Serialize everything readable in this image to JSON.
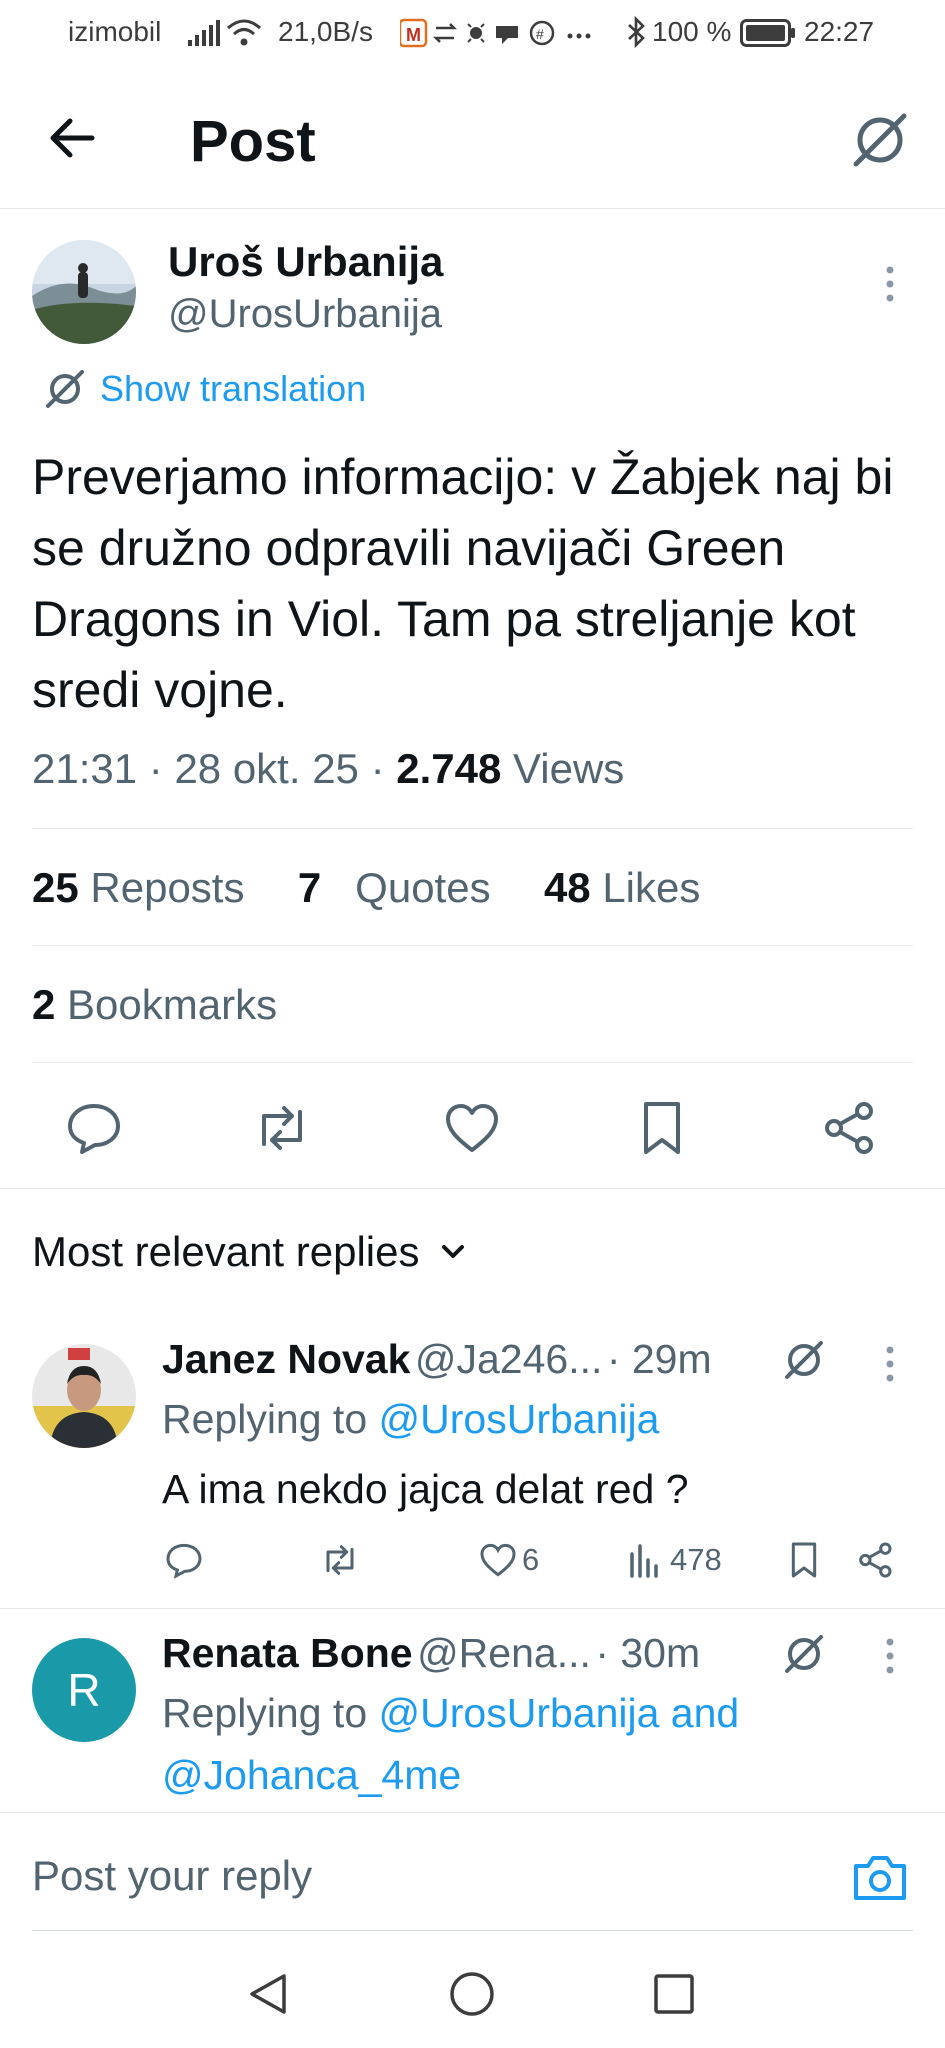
{
  "status_bar": {
    "carrier": "izimobil",
    "speed": "21,0B/s",
    "battery": "100 %",
    "time": "22:27",
    "icons": [
      "signal-icon",
      "wifi-icon",
      "app-notification-icons",
      "bluetooth-icon",
      "battery-icon"
    ]
  },
  "header": {
    "title": "Post"
  },
  "post": {
    "author_name": "Uroš Urbanija",
    "author_handle": "@UrosUrbanija",
    "show_translation": "Show translation",
    "text": "Preverjamo informacijo: v Žabjek naj bi se družno odpravili navijači Green Dragons in Viol. Tam pa streljanje kot sredi vojne.",
    "time": "21:31",
    "date": "28 okt. 25",
    "views_count": "2.748",
    "views_label": "Views",
    "reposts_count": "25",
    "reposts_label": "Reposts",
    "quotes_count": "7",
    "quotes_label": "Quotes",
    "likes_count": "48",
    "likes_label": "Likes",
    "bookmarks_count": "2",
    "bookmarks_label": "Bookmarks"
  },
  "replies_heading": "Most relevant replies",
  "replies": [
    {
      "name": "Janez Novak",
      "handle": "@Ja246...",
      "time": "· 29m",
      "replying_prefix": "Replying to",
      "replying_to": "@UrosUrbanija",
      "text": "A ima nekdo jajca delat red ?",
      "likes": "6",
      "views": "478"
    },
    {
      "name": "Renata Bone",
      "handle": "@Rena...",
      "time": "· 30m",
      "avatar_letter": "R",
      "avatar_color": "#1a9aa8",
      "replying_prefix": "Replying to",
      "replying_to_line1": "@UrosUrbanija and",
      "replying_to_line2": "@Johanca_4me"
    }
  ],
  "reply_box": {
    "placeholder": "Post your reply"
  },
  "colors": {
    "accent": "#1d9bf0",
    "text": "#0f1419",
    "muted": "#536471"
  }
}
